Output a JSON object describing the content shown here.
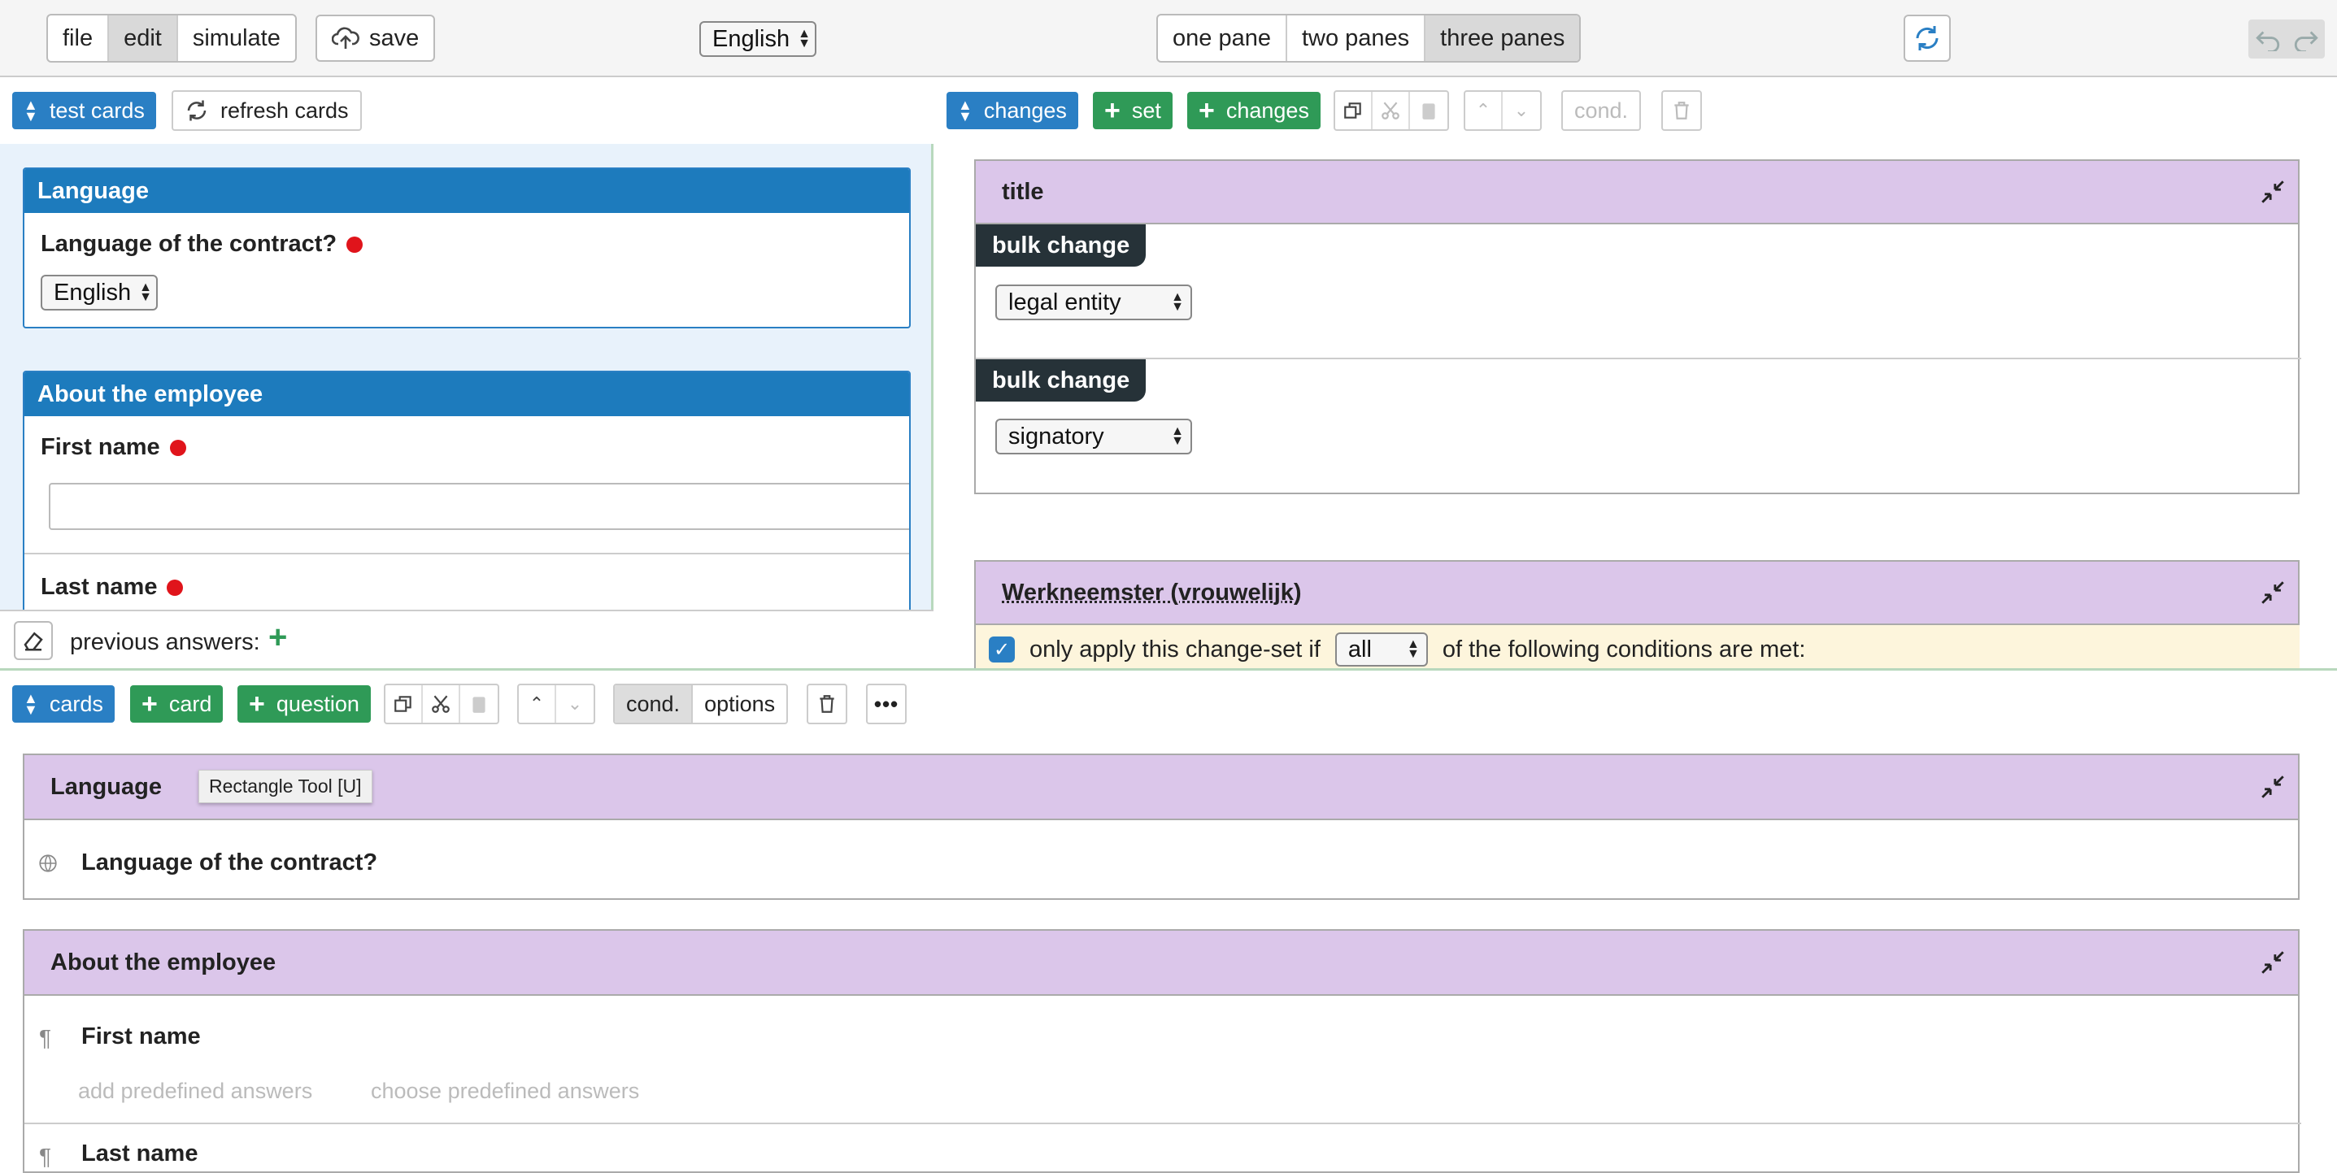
{
  "top_bar": {
    "mode_tabs": [
      "file",
      "edit",
      "simulate"
    ],
    "active_mode": "edit",
    "save_label": "save",
    "language_select": "English",
    "pane_tabs": [
      "one pane",
      "two panes",
      "three panes"
    ],
    "active_pane_tab": "three panes"
  },
  "left_pane": {
    "toolbar": {
      "test_cards": "test cards",
      "refresh_cards": "refresh cards"
    },
    "cards": [
      {
        "title": "Language",
        "question": "Language of the contract?",
        "select_value": "English"
      },
      {
        "title": "About the employee",
        "q1": "First name",
        "q2": "Last name"
      }
    ],
    "footer": {
      "previous_answers": "previous answers:"
    }
  },
  "right_pane": {
    "toolbar": {
      "changes": "changes",
      "set": "set",
      "add_changes": "changes",
      "cond": "cond."
    },
    "sets": [
      {
        "title": "title",
        "changes": [
          {
            "tag": "bulk change",
            "select": "legal entity"
          },
          {
            "tag": "bulk change",
            "select": "signatory"
          }
        ]
      },
      {
        "title": "Werkneemster (vrouwelijk)",
        "condition": {
          "prefix": "only apply this change-set if",
          "select": "all",
          "suffix": "of the following conditions are met:"
        }
      }
    ]
  },
  "bottom_pane": {
    "toolbar": {
      "cards": "cards",
      "card": "card",
      "question": "question",
      "cond": "cond.",
      "options": "options"
    },
    "tooltip": "Rectangle Tool [U]",
    "cards": [
      {
        "title": "Language",
        "questions": [
          "Language of the contract?"
        ]
      },
      {
        "title": "About the employee",
        "questions": [
          "First name",
          "Last name"
        ],
        "add_predefined": "add predefined answers",
        "choose_predefined": "choose predefined answers"
      }
    ]
  },
  "colors": {
    "blue": "#2a7fc4",
    "green": "#2f9a57",
    "purple": "#dbc6ea",
    "required_dot": "#e0141b",
    "tag_dark": "#263238"
  }
}
